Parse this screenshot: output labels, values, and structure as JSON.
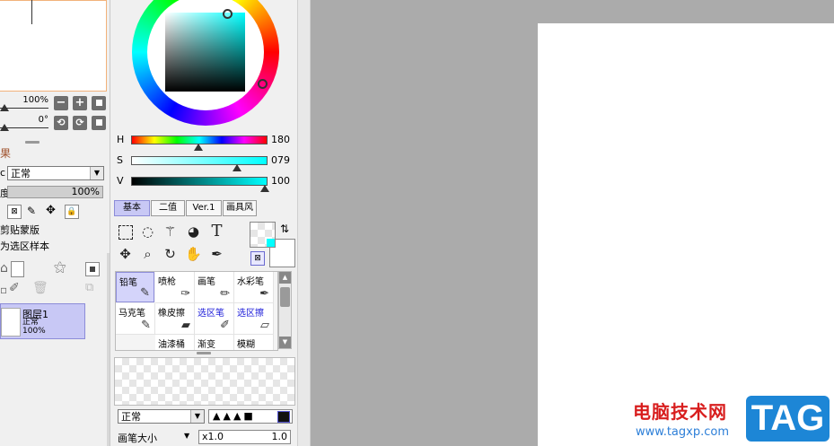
{
  "left_panel": {
    "zoom_value": "100%",
    "angle_value": "0°",
    "effects_label": "果",
    "blend_mode": "正常",
    "opacity_value": "100%",
    "clip_label": "剪贴蒙版",
    "selection_source_label": "为选区样本",
    "layer": {
      "name": "图层1",
      "mode": "正常",
      "opacity": "100%"
    }
  },
  "color": {
    "h_label": "H",
    "h_value": "180",
    "s_label": "S",
    "s_value": "079",
    "v_label": "V",
    "v_value": "100",
    "accent": "#00ffff"
  },
  "tabs": [
    {
      "label": "基本"
    },
    {
      "label": "二值"
    },
    {
      "label": "Ver.1"
    },
    {
      "label": "画具风"
    }
  ],
  "brushes": [
    {
      "label": "铅笔",
      "icon": "pencil-icon"
    },
    {
      "label": "喷枪",
      "icon": "airbrush-icon"
    },
    {
      "label": "画笔",
      "icon": "brush-icon"
    },
    {
      "label": "水彩笔",
      "icon": "watercolor-icon"
    },
    {
      "label": "马克笔",
      "icon": "marker-icon"
    },
    {
      "label": "橡皮擦",
      "icon": "eraser-icon"
    },
    {
      "label": "选区笔",
      "icon": "selection-pen-icon"
    },
    {
      "label": "选区擦",
      "icon": "selection-eraser-icon"
    },
    {
      "label": "油漆桶",
      "icon": "bucket-icon"
    },
    {
      "label": "渐变",
      "icon": "gradient-icon"
    },
    {
      "label": "模糊",
      "icon": "blur-icon"
    }
  ],
  "brush_settings": {
    "blend_mode": "正常",
    "size_label": "画笔大小",
    "size_multiplier": "x1.0",
    "size_value": "1.0"
  },
  "watermark": {
    "text": "电脑技术网",
    "url": "www.tagxp.com",
    "logo": "TAG"
  }
}
